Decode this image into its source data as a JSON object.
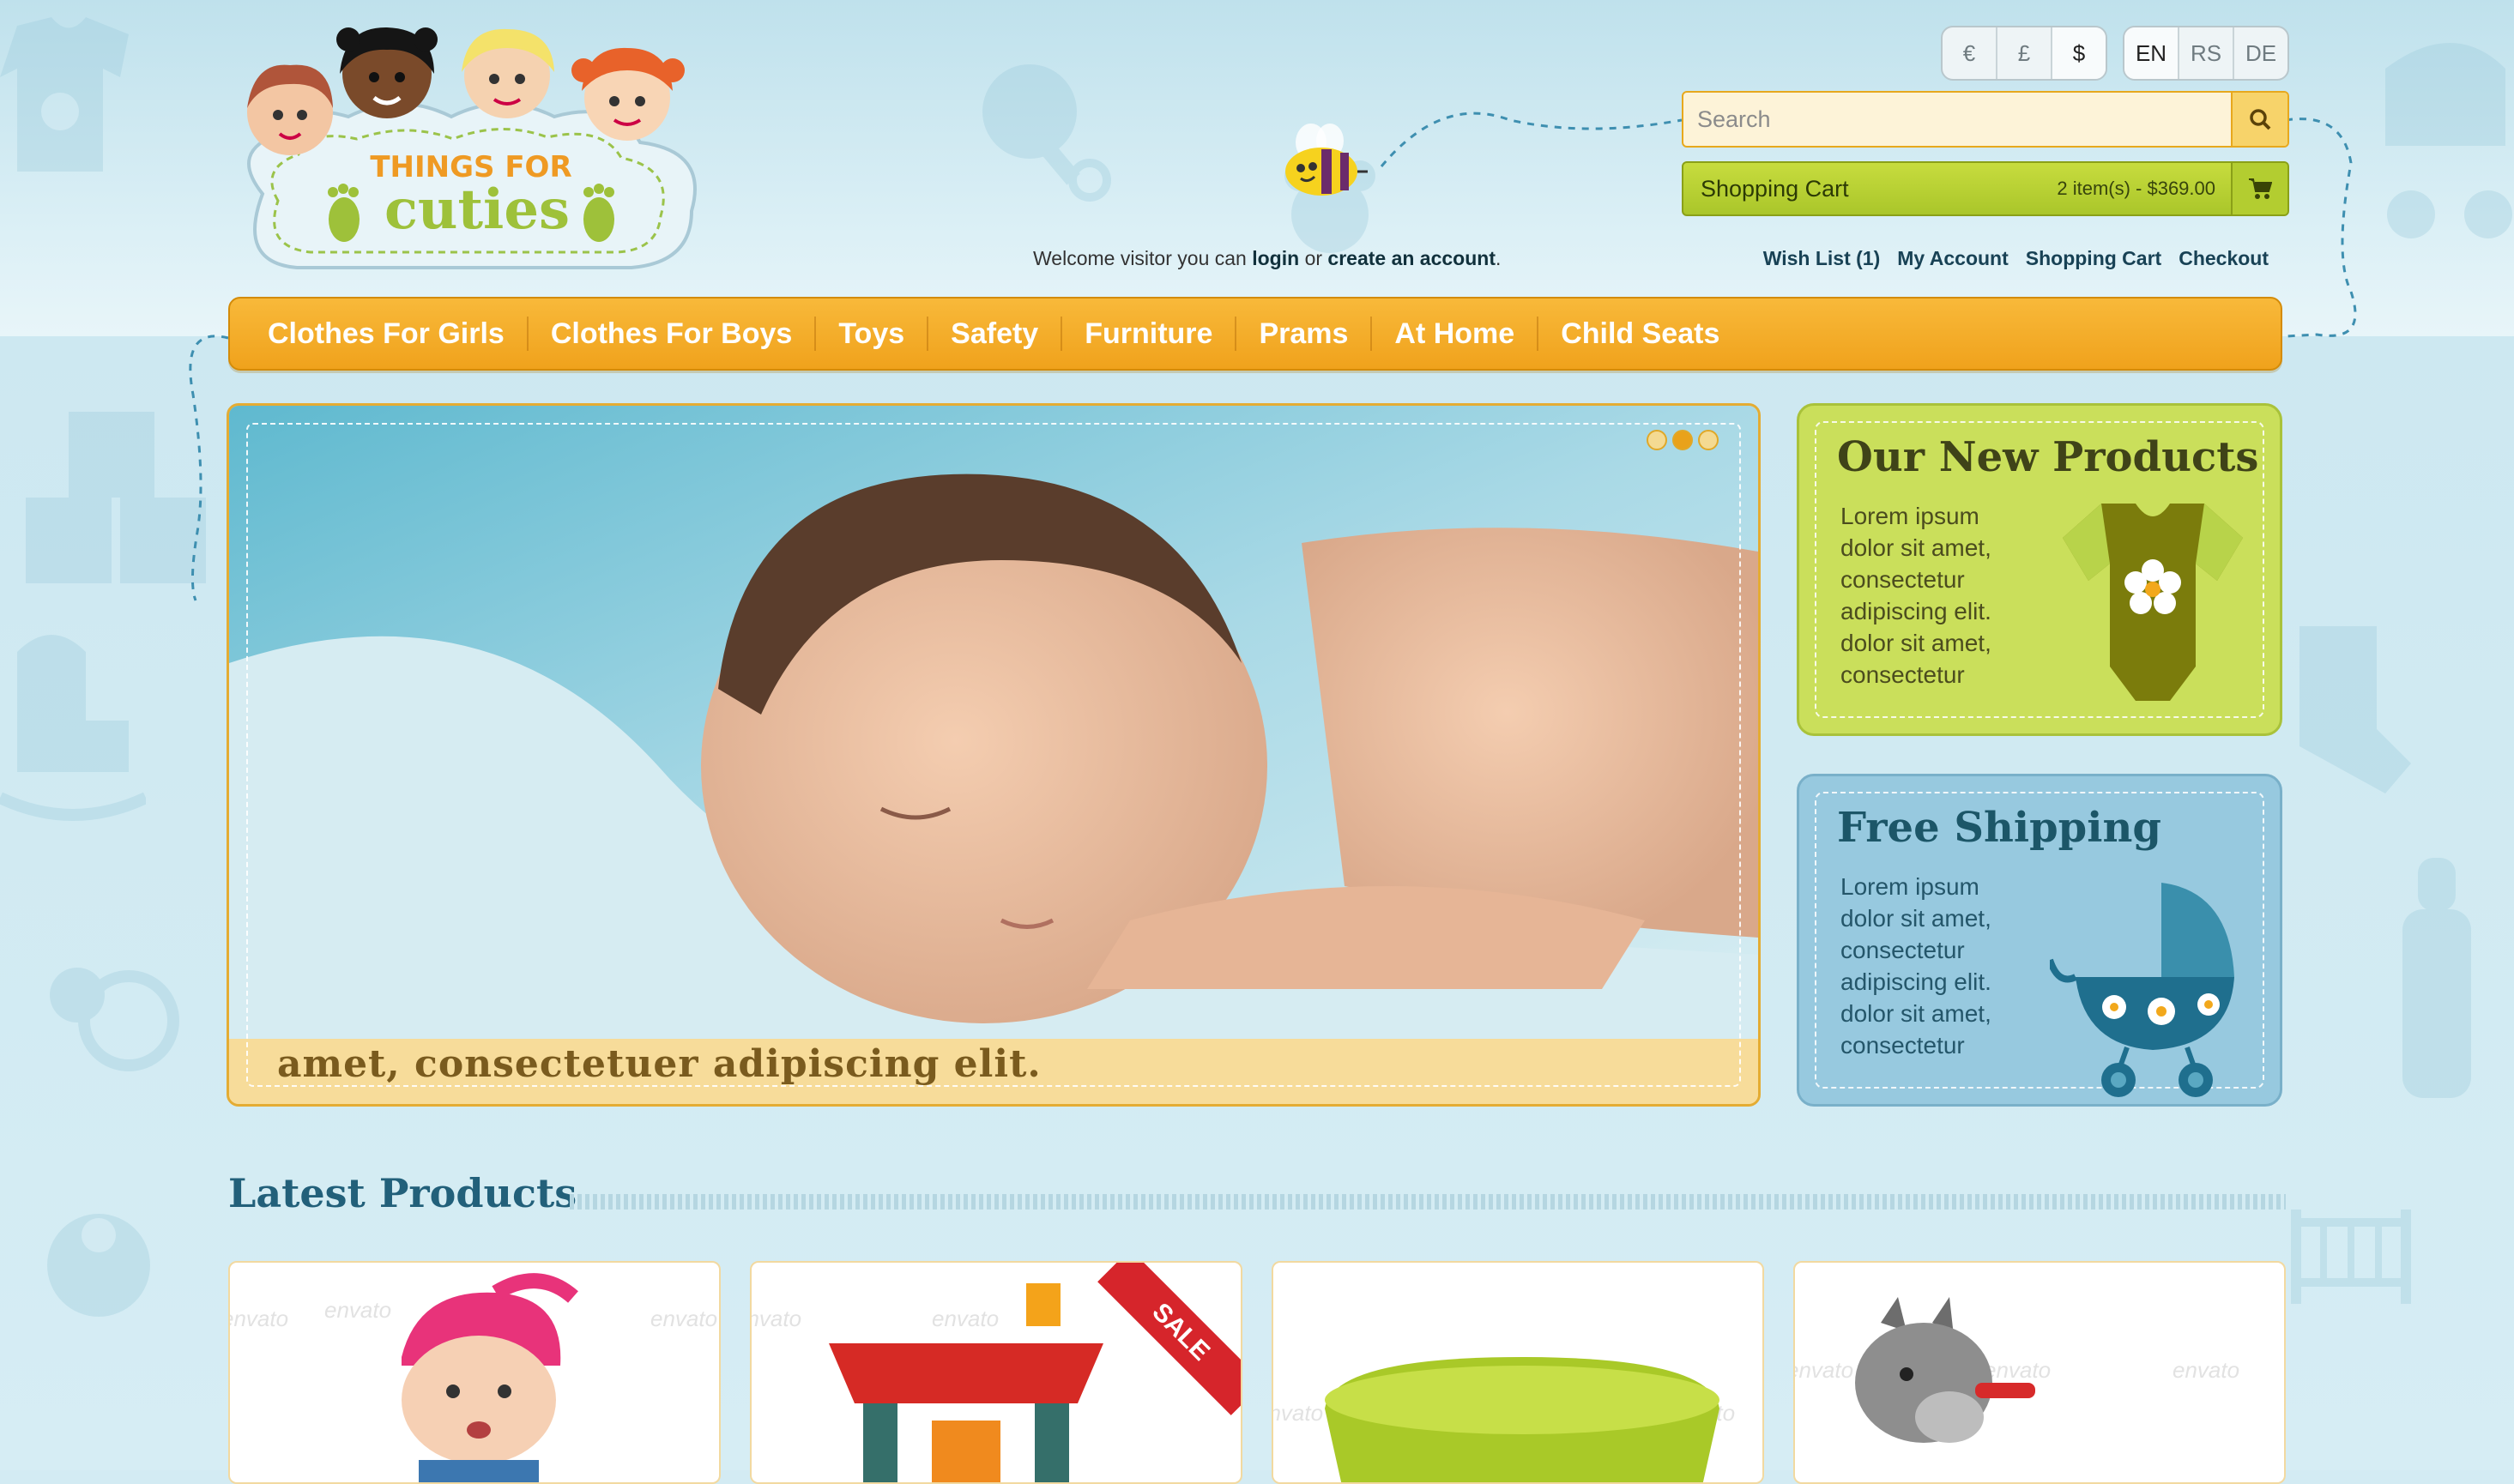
{
  "brand": {
    "line1": "THINGS FOR",
    "line2": "cuties"
  },
  "currencies": [
    {
      "label": "€"
    },
    {
      "label": "£"
    },
    {
      "label": "$"
    }
  ],
  "languages": [
    {
      "label": "EN"
    },
    {
      "label": "RS"
    },
    {
      "label": "DE"
    }
  ],
  "search": {
    "placeholder": "Search",
    "icon": "search-icon"
  },
  "cart": {
    "title": "Shopping Cart",
    "summary": "2 item(s) - $369.00",
    "icon": "cart-icon"
  },
  "welcome": {
    "prefix": "Welcome visitor you can",
    "login": "login",
    "middle": "or",
    "create": "create an account",
    "suffix": "."
  },
  "top_links": [
    "Wish List (1)",
    "My Account",
    "Shopping Cart",
    "Checkout"
  ],
  "nav": [
    "Clothes For Girls",
    "Clothes For Boys",
    "Toys",
    "Safety",
    "Furniture",
    "Prams",
    "At Home",
    "Child Seats"
  ],
  "slider": {
    "caption": "amet, consectetuer adipiscing elit.",
    "slides": 3,
    "active_slide": 2
  },
  "promos": [
    {
      "title": "Our New Products",
      "text": "Lorem ipsum dolor sit amet, consectetur adipiscing elit. dolor sit amet, consectetur",
      "icon": "onesie-icon"
    },
    {
      "title": "Free Shipping",
      "text": "Lorem ipsum dolor sit amet, consectetur adipiscing elit. dolor sit amet, consectetur",
      "icon": "pram-icon"
    }
  ],
  "latest": {
    "title": "Latest Products",
    "products": [
      {
        "image": "baby-in-pink-hat",
        "badge": ""
      },
      {
        "image": "wooden-toy-house",
        "badge": "SALE"
      },
      {
        "image": "green-potty",
        "badge": ""
      },
      {
        "image": "rocking-donkey",
        "badge": ""
      }
    ],
    "watermark": "envato"
  },
  "colors": {
    "nav": "#f0a21c",
    "cart": "#b3cd30",
    "promo_new": "#cadf5b",
    "promo_shipping": "#97c9df",
    "title": "#22607a",
    "sale": "#d6252b"
  }
}
